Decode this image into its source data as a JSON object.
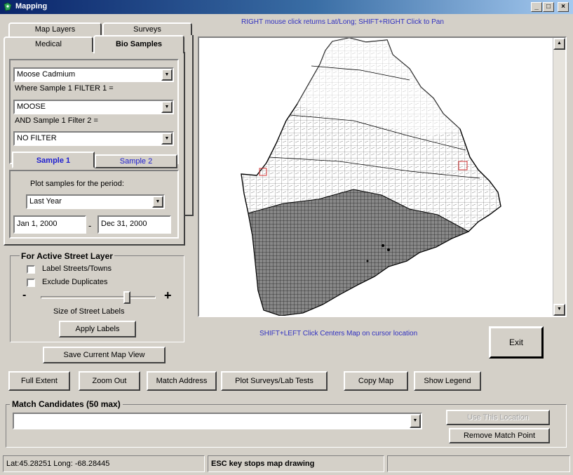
{
  "window": {
    "title": "Mapping",
    "controls": [
      "_",
      "□",
      "×"
    ]
  },
  "tabs_top": [
    "Map Layers",
    "Surveys"
  ],
  "tabs_bottom": [
    "Medical",
    "Bio Samples"
  ],
  "bio_samples": {
    "sample_type": "Moose Cadmium",
    "filter1_label": "Where Sample 1 FILTER 1 =",
    "filter1_value": "MOOSE",
    "filter2_label": "AND Sample 1 Filter 2 =",
    "filter2_value": "NO FILTER",
    "sample1_tab": "Sample 1",
    "sample2_tab": "Sample 2",
    "period_label": "Plot samples for the period:",
    "period_value": "Last Year",
    "date_from": "Jan 1, 2000",
    "date_sep": "-",
    "date_to": "Dec 31, 2000"
  },
  "street_layer": {
    "title": "For Active Street Layer",
    "label_streets": "Label Streets/Towns",
    "exclude_duplicates": "Exclude Duplicates",
    "minus": "-",
    "plus": "+",
    "size_label": "Size of Street Labels",
    "apply_labels": "Apply Labels"
  },
  "hints": {
    "top": "RIGHT mouse click returns Lat/Long; SHIFT+RIGHT Click to Pan",
    "bottom": "SHIFT+LEFT Click Centers Map on cursor location"
  },
  "buttons": {
    "save_view": "Save Current Map View",
    "exit": "Exit",
    "full_extent": "Full Extent",
    "zoom_out": "Zoom Out",
    "match_address": "Match Address",
    "plot_surveys": "Plot Surveys/Lab Tests",
    "copy_map": "Copy Map",
    "show_legend": "Show Legend",
    "use_this_location": "Use This Location",
    "remove_match_point": "Remove Match Point"
  },
  "match": {
    "title": "Match Candidates (50 max)",
    "value": ""
  },
  "status": {
    "coords": "Lat:45.28251 Long: -68.28445",
    "message": "ESC key stops map drawing"
  }
}
